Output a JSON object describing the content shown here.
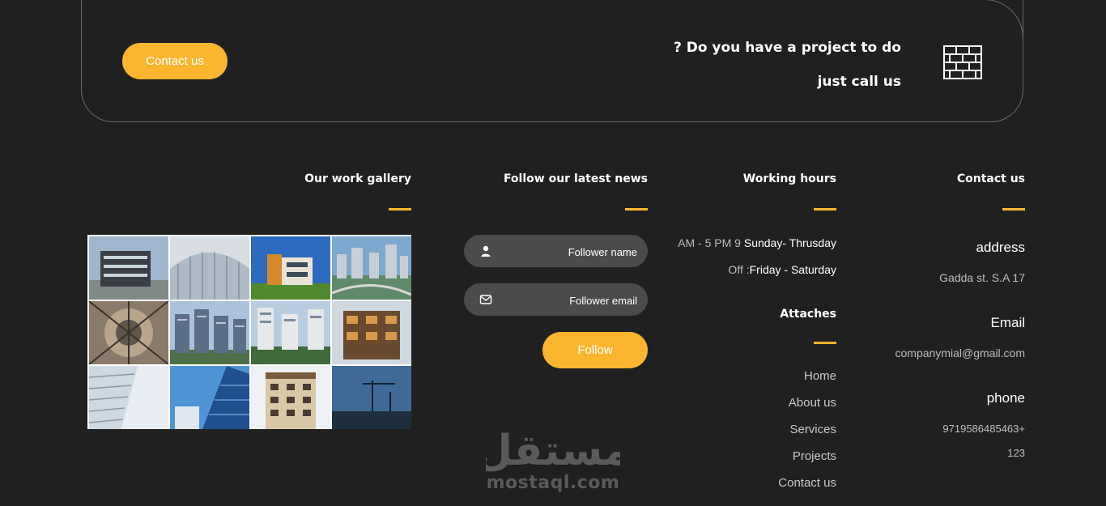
{
  "cta": {
    "button_label": "Contact us",
    "line1": "? Do you have a project to do",
    "line2": "just call us",
    "icon": "brick-wall-icon"
  },
  "columns": {
    "gallery_title": "Our work gallery",
    "news_title": "Follow our latest news",
    "hours_title": "Working hours",
    "contact_title": "Contact us"
  },
  "contact": {
    "address_label": "address",
    "address_value": "Gadda st. S.A 17",
    "email_label": "Email",
    "email_value": "companymial@gmail.com",
    "phone_label": "phone",
    "phone_value": "9719586485463+",
    "phone_extra": "123"
  },
  "hours": {
    "weekday_time": "AM - 5 PM 9",
    "weekday_days": "Sunday- Thrusday",
    "weekend_prefix": "Off :",
    "weekend_days": "Friday - Saturday"
  },
  "attaches": {
    "title": "Attaches",
    "links": [
      "Home",
      "About us",
      "Services",
      "Projects",
      "Contact us"
    ]
  },
  "news": {
    "name_placeholder": "Follower name",
    "email_placeholder": "Follower email",
    "follow_label": "Follow",
    "name_icon": "user-icon",
    "email_icon": "envelope-icon"
  },
  "gallery": {
    "tiles": [
      "building-photo",
      "building-photo",
      "building-photo",
      "building-photo",
      "building-photo",
      "building-photo",
      "building-photo",
      "building-photo",
      "building-photo",
      "building-photo",
      "building-photo",
      "building-photo"
    ]
  },
  "watermark": {
    "latin": "mostaql.com",
    "arabic": "مستقل"
  },
  "colors": {
    "accent": "#fbb52f",
    "background": "#202020",
    "input_bg": "#4b4b4b",
    "muted_text": "#bdbdbd"
  }
}
